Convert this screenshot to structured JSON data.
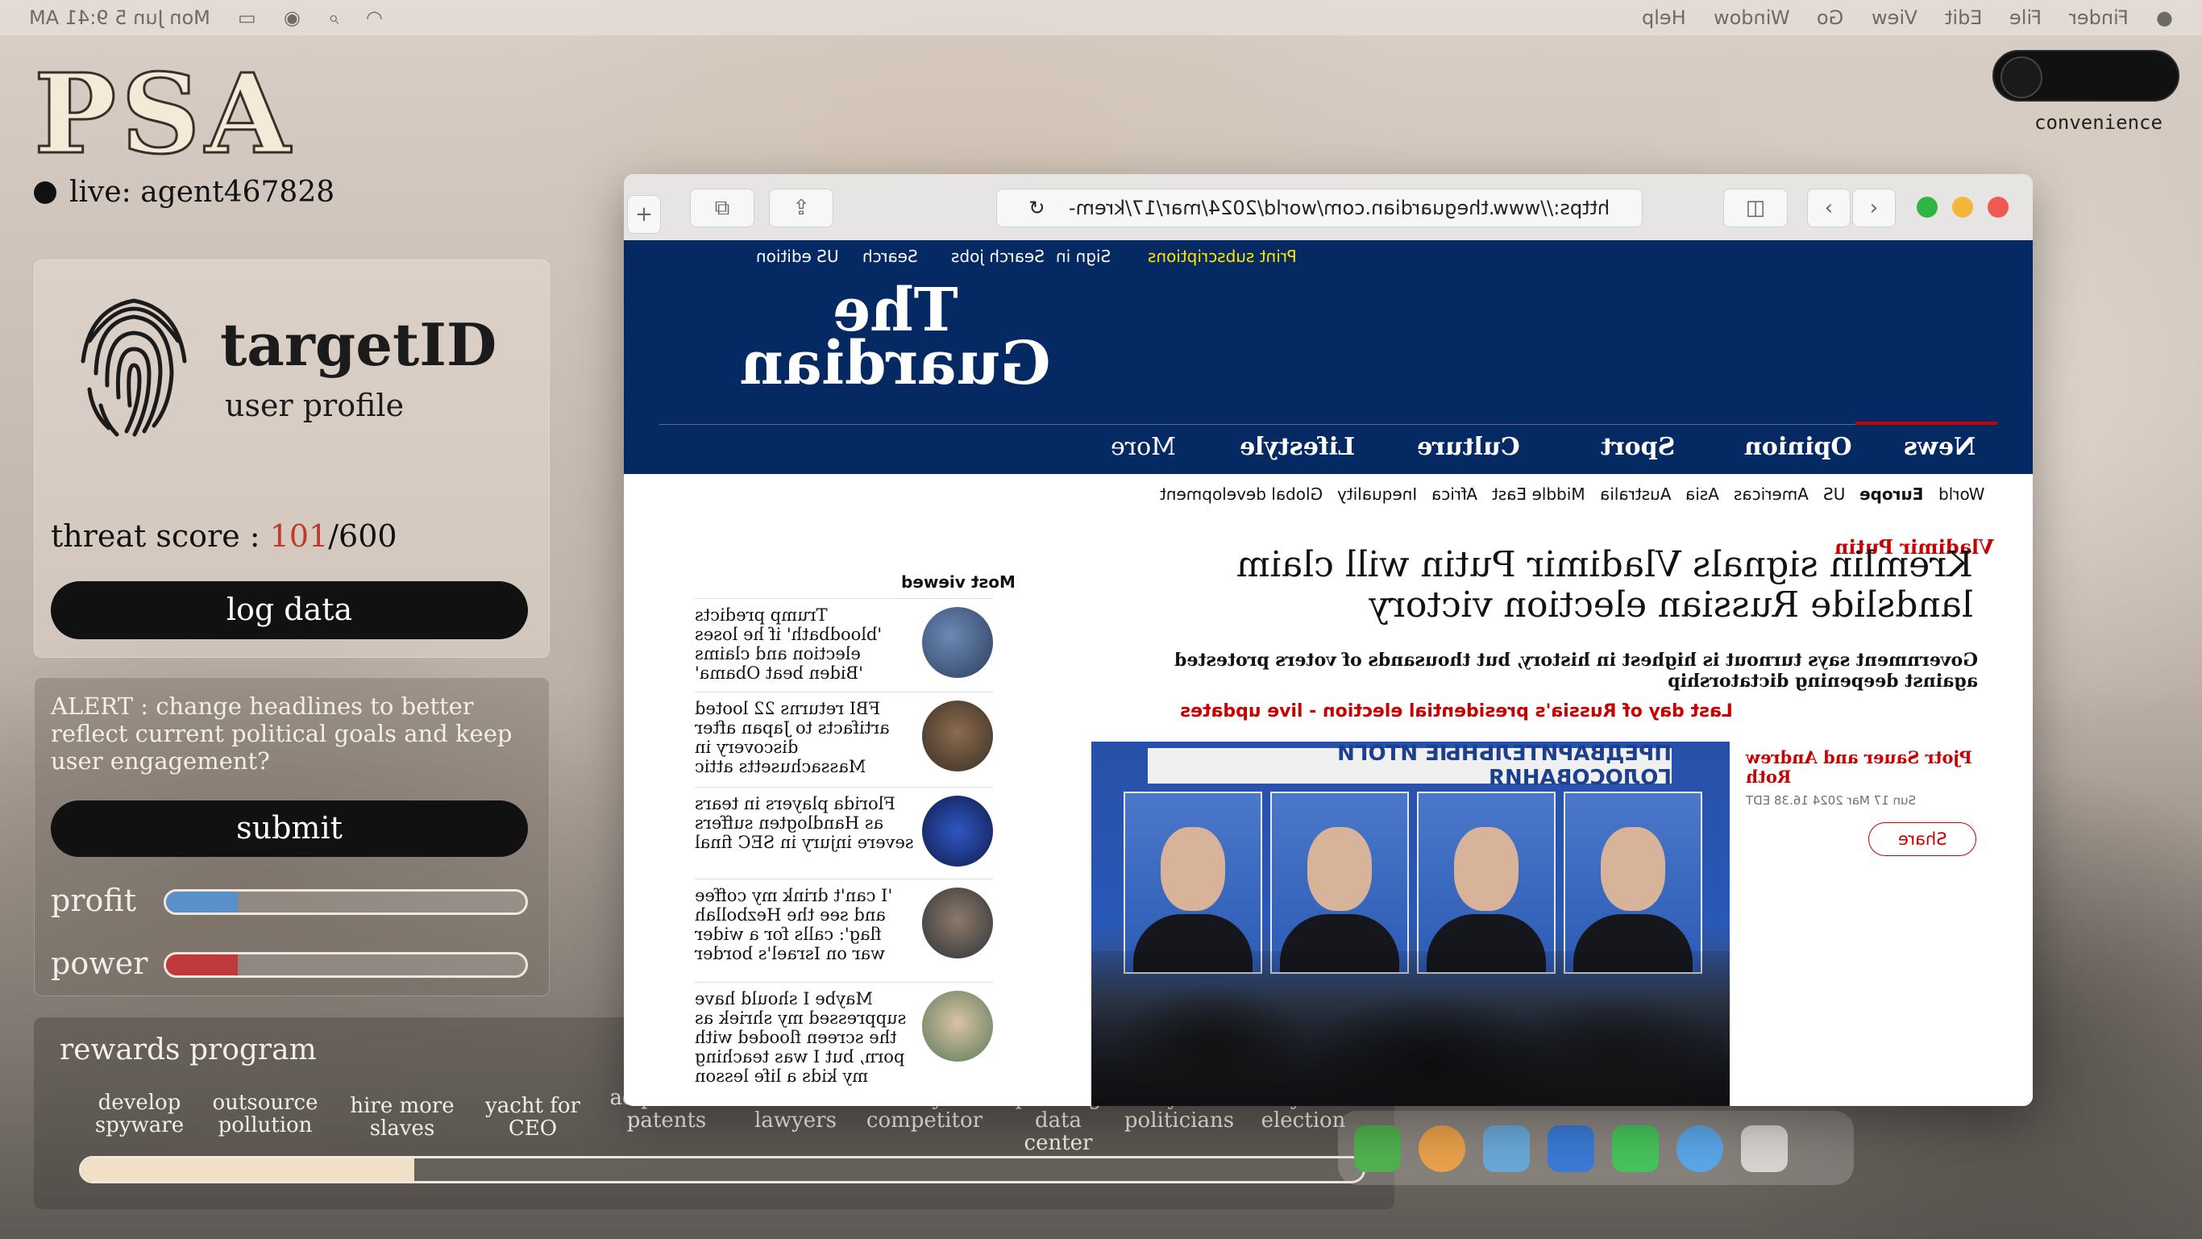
{
  "menubar": {
    "left": [
      "Mon Jun 5  9:41 AM"
    ],
    "right": [
      "Help",
      "Window",
      "Go",
      "View",
      "Edit",
      "File",
      "Finder"
    ]
  },
  "app": {
    "logo": "PSA",
    "live_label": "live: agent467828",
    "profile_title": "targetID",
    "profile_subtitle": "user profile",
    "threat_label": "threat score : ",
    "threat_value": "101",
    "threat_max": "/600",
    "log_button": "log data",
    "alert_text": "ALERT : change headlines to better reflect current political goals and keep user engagement?",
    "submit_button": "submit",
    "profit_label": "profit",
    "profit_level": 0.2,
    "power_label": "power",
    "power_level": 0.2,
    "toggle_label": "convenience",
    "colors": {
      "threat": "#c0392b",
      "profit": "#5b8fc9",
      "power": "#c0393b"
    }
  },
  "rewards": {
    "title": "rewards program",
    "items": [
      "develop spyware",
      "outsource pollution",
      "hire more slaves",
      "yacht for CEO",
      "acquire 25 patents",
      "fire all lawyers",
      "buy competitor",
      "open huge data center",
      "buy US politicians",
      "buy the election"
    ],
    "progress": 0.26
  },
  "browser": {
    "url": "https://www.theguardian.com/world/2024/mar/17/krem-",
    "util": {
      "print": "Print subscriptions",
      "signin": "Sign in",
      "jobs": "Search jobs",
      "search": "Search",
      "edition": "US edition"
    },
    "logo_line1": "The",
    "logo_line2": "Guardian",
    "nav": [
      "News",
      "Opinion",
      "Sport",
      "Culture",
      "Lifestyle",
      "More"
    ],
    "subnav": [
      "World",
      "Europe",
      "US",
      "Americas",
      "Asia",
      "Australia",
      "Middle East",
      "Africa",
      "Inequality",
      "Global development"
    ],
    "section_tag": "Vladimir Putin",
    "headline": "Kremlin signals Vladimir Putin will claim landslide Russian election victory",
    "standfirst": "Government says turnout is highest in history, but thousands of voters protested against deepening dictatorship",
    "live_link": "Last day of Russia's presidential election - live updates",
    "photo_banner": "ПРЕДВАРИТЕЛЬНЫЕ ИТОГИ ГОЛОСОВАНИЯ",
    "byline": "Pjotr Sauer and Andrew Roth",
    "date": "Sun 17 Mar 2024 16.38 EDT",
    "share": "Share",
    "most_viewed_title": "Most viewed",
    "most_viewed": [
      "Trump predicts 'bloodbath' if he loses election and claims 'Biden beat Obama'",
      "FBI returns 22 looted artifacts to Japan after discovery in Massachusetts attic",
      "Florida players in tears as Handlogten suffers severe injury in SEC final",
      "'I can't drink my coffee and see the Hezbollah flag': calls for a wider war on Israel's border",
      "Maybe I should have suppressed my shriek as the screen flooded with porn, but I was teaching my kids a life lesson"
    ]
  }
}
